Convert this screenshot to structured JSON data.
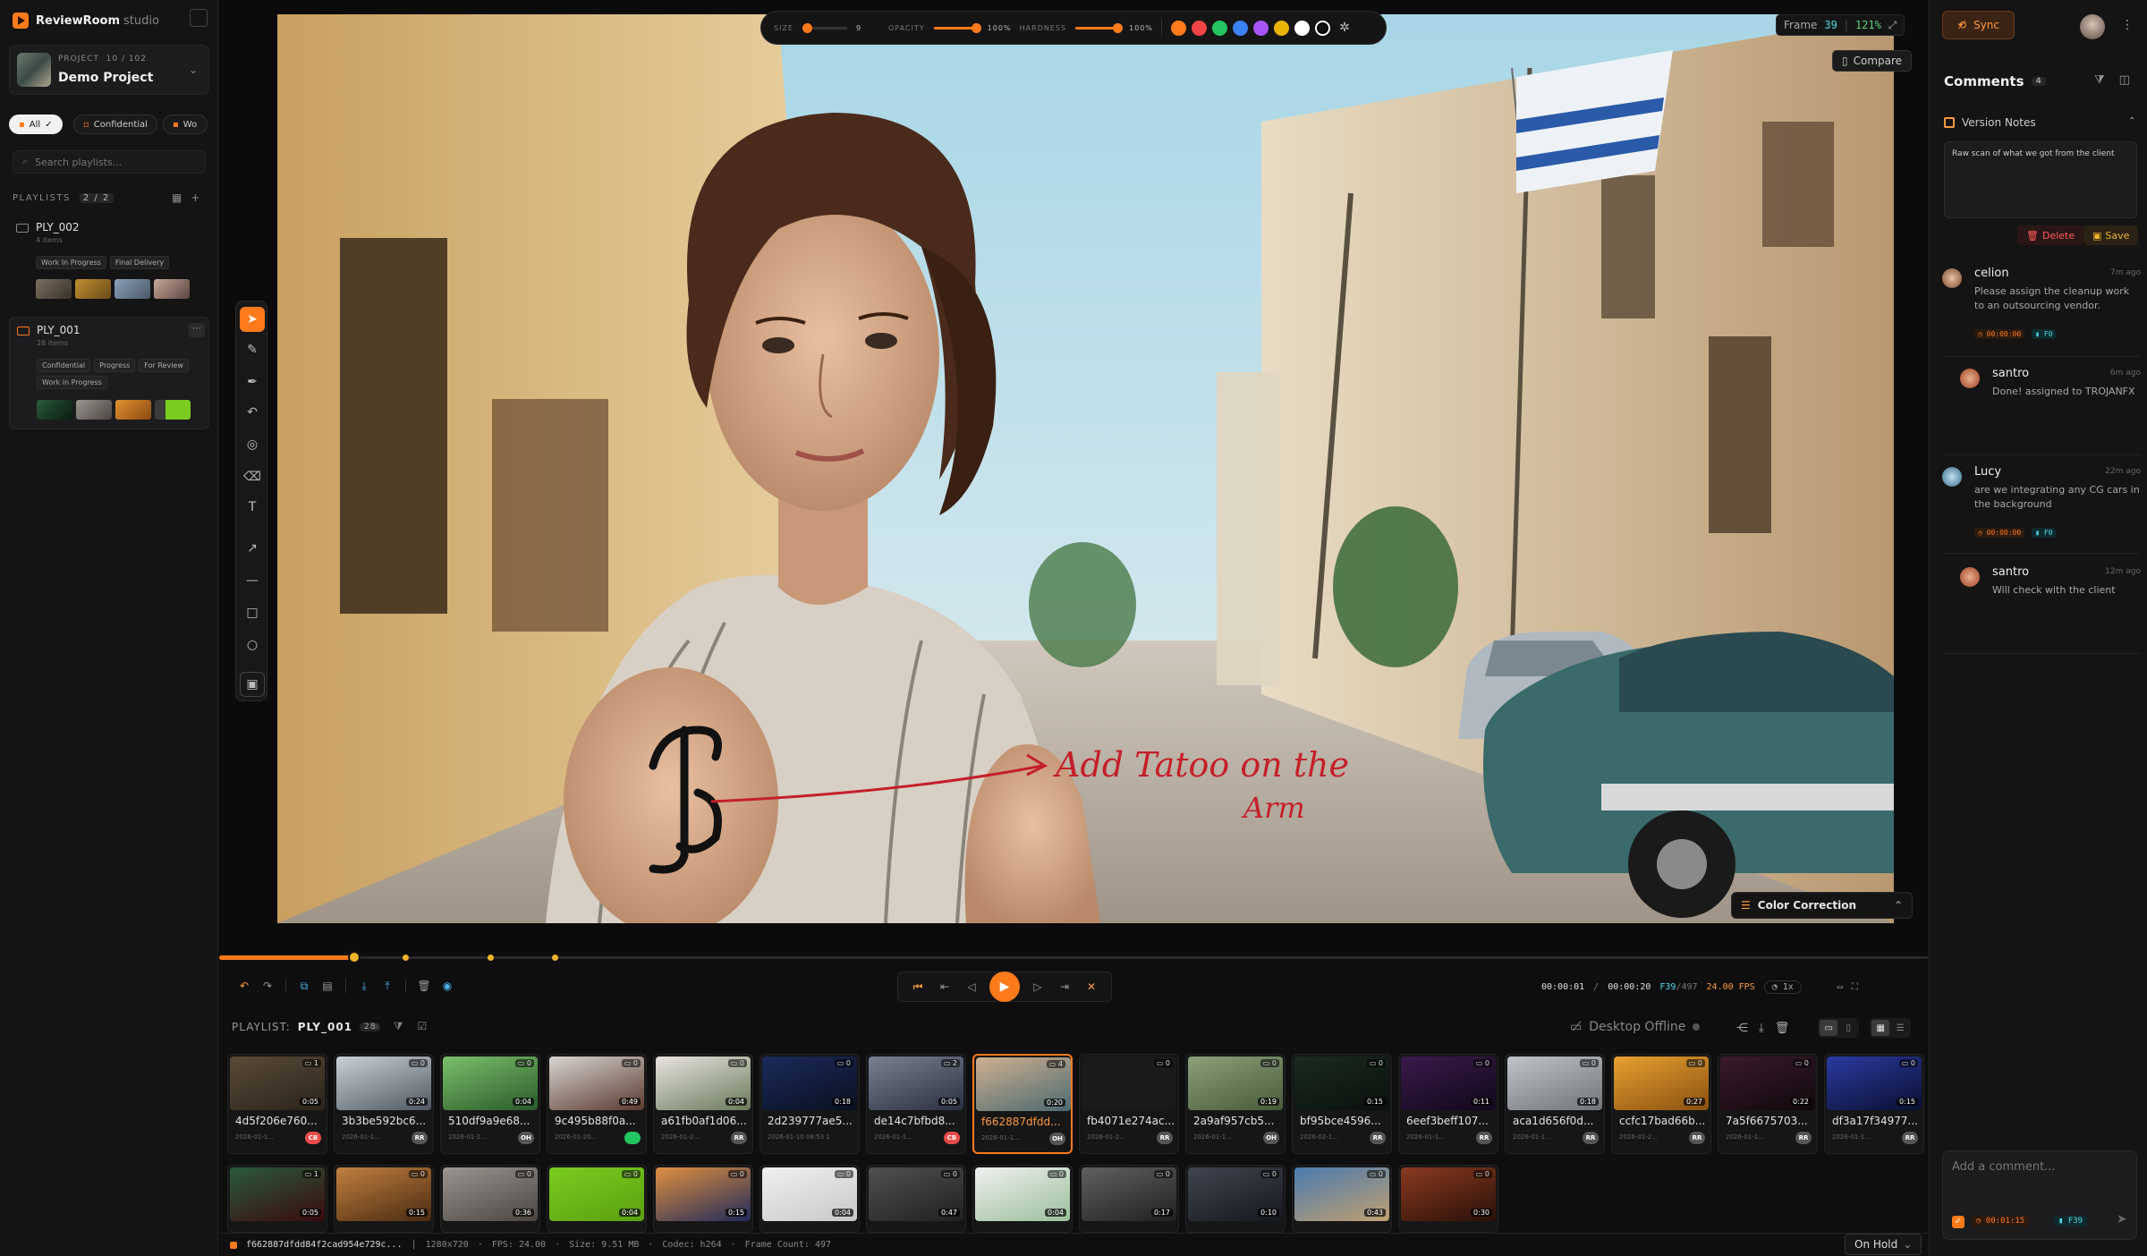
{
  "app": {
    "name": "ReviewRoom",
    "suffix": "studio"
  },
  "project": {
    "label": "PROJECT",
    "counter": "10 / 102",
    "name": "Demo Project"
  },
  "filters": {
    "all": "All",
    "confidential": "Confidential",
    "work": "Wo"
  },
  "playlist_search": {
    "placeholder": "Search playlists..."
  },
  "playlists": {
    "heading": "PLAYLISTS",
    "count": "2 / 2",
    "items": [
      {
        "name": "PLY_002",
        "sub": "4 items",
        "tags": [
          "Work In Progress",
          "Final Delivery"
        ]
      },
      {
        "name": "PLY_001",
        "sub": "28 items",
        "tags": [
          "Confidential",
          "Progress",
          "For Review",
          "Work in Progress"
        ]
      }
    ]
  },
  "brush": {
    "size_label": "SIZE",
    "size_value": "9",
    "opacity_label": "OPACITY",
    "opacity_value": "100%",
    "hardness_label": "HARDNESS",
    "hardness_value": "100%",
    "colors": [
      "#ff7a1a",
      "#ef4444",
      "#22c55e",
      "#3b82f6",
      "#a855f7",
      "#eab308",
      "#ffffff",
      "#111111"
    ]
  },
  "frame_badge": {
    "label": "Frame",
    "frame": "39",
    "zoom": "121%"
  },
  "compare_label": "Compare",
  "annotation_text": {
    "line1": "Add Tatoo on the",
    "line2": "Arm"
  },
  "color_correction_label": "Color Correction",
  "timeline": {
    "progress": 0.079
  },
  "timecode": {
    "current": "00:00:01",
    "total": "00:00:20",
    "frame": "F39",
    "frame_total": "/497",
    "fps": "24.00 FPS",
    "speed": "1x"
  },
  "playlist_bar": {
    "label": "PLAYLIST:",
    "name": "PLY_001",
    "count": "28",
    "offline": "Desktop Offline"
  },
  "thumbnails": [
    {
      "name": "4d5f206e760...",
      "date": "2026-01-1...",
      "comments": "1",
      "dur": "0:05",
      "av": "CB",
      "avc": "#e84a4a",
      "c1": "#5a4a35",
      "c2": "#2a241c"
    },
    {
      "name": "3b3be592bc6...",
      "date": "2026-01-1...",
      "comments": "0",
      "dur": "0:24",
      "av": "RR",
      "avc": "#555",
      "c1": "#c8d0d8",
      "c2": "#505860"
    },
    {
      "name": "510df9a9e68...",
      "date": "2026-01-2...",
      "comments": "0",
      "dur": "0:04",
      "av": "OH",
      "avc": "#555",
      "c1": "#7ac06a",
      "c2": "#2a5a2a"
    },
    {
      "name": "9c495b88f0a...",
      "date": "2026-01-20...",
      "comments": "0",
      "dur": "0:49",
      "av": "",
      "avc": "#22c55e",
      "c1": "#d8d4d0",
      "c2": "#5a3a30"
    },
    {
      "name": "a61fb0af1d06...",
      "date": "2026-01-2...",
      "comments": "0",
      "dur": "0:04",
      "av": "RR",
      "avc": "#555",
      "c1": "#e8e4e0",
      "c2": "#6a7a5a"
    },
    {
      "name": "2d239777ae5...",
      "date": "2026-01-10 08:53 1...",
      "comments": "0",
      "dur": "0:18",
      "av": "",
      "avc": "#161617",
      "c1": "#1a2a5a",
      "c2": "#0a1020"
    },
    {
      "name": "de14c7bfbd8...",
      "date": "2026-01-1...",
      "comments": "2",
      "dur": "0:05",
      "av": "CB",
      "avc": "#e84a4a",
      "c1": "#7a8090",
      "c2": "#2a3040"
    },
    {
      "name": "f662887dfdd...",
      "date": "2026-01-1...",
      "comments": "4",
      "dur": "0:20",
      "av": "OH",
      "avc": "#555",
      "c1": "#d0b090",
      "c2": "#4a6a70",
      "sel": true
    },
    {
      "name": "fb4071e274ac...",
      "date": "2026-01-2...",
      "comments": "0",
      "dur": "",
      "av": "RR",
      "avc": "#555",
      "c1": "#1a1a1b",
      "c2": "#1a1a1b"
    },
    {
      "name": "2a9af957cb5...",
      "date": "2026-01-1...",
      "comments": "0",
      "dur": "0:19",
      "av": "OH",
      "avc": "#555",
      "c1": "#8aa07a",
      "c2": "#4a5a3a"
    },
    {
      "name": "bf95bce4596...",
      "date": "2026-02-1...",
      "comments": "0",
      "dur": "0:15",
      "av": "RR",
      "avc": "#555",
      "c1": "#1a2a20",
      "c2": "#0a100c"
    },
    {
      "name": "6eef3beff107...",
      "date": "2026-01-1...",
      "comments": "0",
      "dur": "0:11",
      "av": "RR",
      "avc": "#555",
      "c1": "#3a1a4a",
      "c2": "#10081a"
    },
    {
      "name": "aca1d656f0d...",
      "date": "2026-01-1...",
      "comments": "0",
      "dur": "0:18",
      "av": "RR",
      "avc": "#555",
      "c1": "#c0c4c8",
      "c2": "#707478"
    },
    {
      "name": "ccfc17bad66b...",
      "date": "2026-01-2...",
      "comments": "0",
      "dur": "0:27",
      "av": "RR",
      "avc": "#555",
      "c1": "#e8a030",
      "c2": "#8a5010"
    },
    {
      "name": "7a5f6675703...",
      "date": "2026-01-1...",
      "comments": "0",
      "dur": "0:22",
      "av": "RR",
      "avc": "#555",
      "c1": "#3a1a2a",
      "c2": "#10080c"
    },
    {
      "name": "df3a17f34977...",
      "date": "2026-01-1...",
      "comments": "0",
      "dur": "0:15",
      "av": "RR",
      "avc": "#555",
      "c1": "#2a3aa0",
      "c2": "#0a1030"
    },
    {
      "name": "",
      "date": "",
      "comments": "1",
      "dur": "0:05",
      "av": "",
      "avc": "#161617",
      "c1": "#2a5a3a",
      "c2": "#3a0a10"
    },
    {
      "name": "",
      "date": "",
      "comments": "0",
      "dur": "0:15",
      "av": "",
      "avc": "#161617",
      "c1": "#c08040",
      "c2": "#4a2a10"
    },
    {
      "name": "",
      "date": "",
      "comments": "0",
      "dur": "0:36",
      "av": "",
      "avc": "#161617",
      "c1": "#9a9590",
      "c2": "#4a4540"
    },
    {
      "name": "",
      "date": "",
      "comments": "0",
      "dur": "0:04",
      "av": "",
      "avc": "#161617",
      "c1": "#7acc20",
      "c2": "#5aa010"
    },
    {
      "name": "",
      "date": "",
      "comments": "0",
      "dur": "0:15",
      "av": "",
      "avc": "#161617",
      "c1": "#e09040",
      "c2": "#202a5a"
    },
    {
      "name": "",
      "date": "",
      "comments": "0",
      "dur": "0:04",
      "av": "",
      "avc": "#161617",
      "c1": "#f0f0f0",
      "c2": "#c8c8c8"
    },
    {
      "name": "",
      "date": "",
      "comments": "0",
      "dur": "0:47",
      "av": "",
      "avc": "#161617",
      "c1": "#505050",
      "c2": "#202020"
    },
    {
      "name": "",
      "date": "",
      "comments": "0",
      "dur": "0:04",
      "av": "",
      "avc": "#161617",
      "c1": "#f0f0f0",
      "c2": "#9abf9a"
    },
    {
      "name": "",
      "date": "",
      "comments": "0",
      "dur": "0:17",
      "av": "",
      "avc": "#161617",
      "c1": "#606060",
      "c2": "#202020"
    },
    {
      "name": "",
      "date": "",
      "comments": "0",
      "dur": "0:10",
      "av": "",
      "avc": "#161617",
      "c1": "#404550",
      "c2": "#15181c"
    },
    {
      "name": "",
      "date": "",
      "comments": "0",
      "dur": "0:43",
      "av": "",
      "avc": "#161617",
      "c1": "#4a7ab0",
      "c2": "#c0a070"
    },
    {
      "name": "",
      "date": "",
      "comments": "0",
      "dur": "0:30",
      "av": "",
      "avc": "#161617",
      "c1": "#8a3a20",
      "c2": "#2a1008"
    }
  ],
  "status_bar": {
    "file": "f662887dfdd84f2cad954e729c...",
    "resolution": "1280x720",
    "fps": "FPS: 24.00",
    "size": "Size: 9.51 MB",
    "codec": "Codec: h264",
    "frames": "Frame Count: 497"
  },
  "status_select": "On Hold",
  "right_panel": {
    "sync": "Sync",
    "comments_title": "Comments",
    "comments_count": "4",
    "version_notes_title": "Version Notes",
    "version_notes_text": "Raw scan of what we got from the client",
    "delete": "Delete",
    "save": "Save",
    "comments": [
      {
        "user": "celion",
        "time": "7m ago",
        "text": "Please assign the cleanup work to an outsourcing vendor.",
        "tc": "00:00:00",
        "frame": "F0"
      },
      {
        "user": "santro",
        "time": "6m ago",
        "text": "Done! assigned to TROJANFX",
        "tc": "",
        "frame": ""
      },
      {
        "user": "Lucy",
        "time": "22m ago",
        "text": "are we integrating any CG cars in the background",
        "tc": "00:00:00",
        "frame": "F0"
      },
      {
        "user": "santro",
        "time": "12m ago",
        "text": "Will check with the client",
        "tc": "",
        "frame": ""
      }
    ],
    "add_comment_placeholder": "Add a comment...",
    "add_tc": "00:01:15",
    "add_frame": "F39"
  }
}
